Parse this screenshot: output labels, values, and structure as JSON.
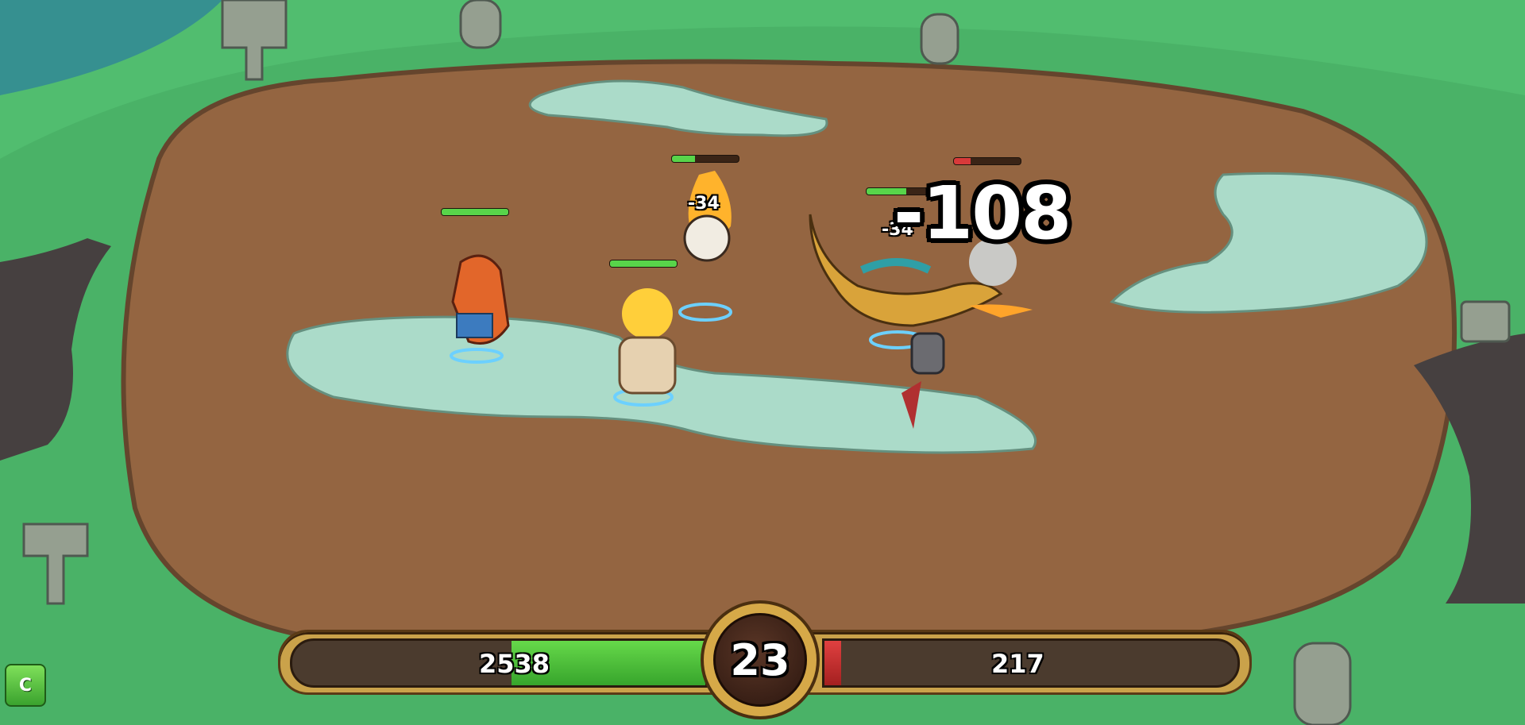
{
  "battle": {
    "left_team_hp": "2538",
    "right_team_hp": "217",
    "timer": "23",
    "left_hp_fraction": 0.47,
    "right_hp_fraction": 0.04,
    "colors": {
      "left_bar": "#4ccf3a",
      "right_bar": "#c23030",
      "frame": "#caa24a"
    }
  },
  "damage_numbers": {
    "big": "-108",
    "skull_hit": "-34",
    "dino_hit": "-34"
  },
  "units": {
    "orange_lizard_hp": 1.0,
    "flame_skull_hp": 0.35,
    "fire_brute_hp": 1.0,
    "raptor_hp": 0.6,
    "knight_enemy_hp": 0.25
  },
  "controls": {
    "c_button_label": "C"
  }
}
